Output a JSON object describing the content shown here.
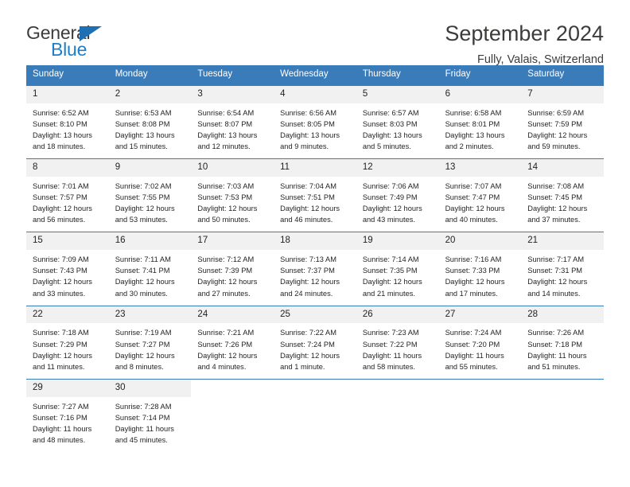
{
  "brand": {
    "name_top": "General",
    "name_bottom": "Blue",
    "triangle_color": "#1f6fb5",
    "blue_color": "#1f7fc4",
    "gray_color": "#3c3c3b"
  },
  "header": {
    "title": "September 2024",
    "subtitle": "Fully, Valais, Switzerland"
  },
  "colors": {
    "header_bg": "#3a7cba",
    "header_text": "#ffffff",
    "daynum_bg": "#f1f1f1",
    "cell_bg": "#ffffff",
    "text": "#231f20"
  },
  "weekdays": [
    "Sunday",
    "Monday",
    "Tuesday",
    "Wednesday",
    "Thursday",
    "Friday",
    "Saturday"
  ],
  "weeks": [
    [
      {
        "day": "1",
        "sunrise": "Sunrise: 6:52 AM",
        "sunset": "Sunset: 8:10 PM",
        "daylight_line1": "Daylight: 13 hours",
        "daylight_line2": "and 18 minutes."
      },
      {
        "day": "2",
        "sunrise": "Sunrise: 6:53 AM",
        "sunset": "Sunset: 8:08 PM",
        "daylight_line1": "Daylight: 13 hours",
        "daylight_line2": "and 15 minutes."
      },
      {
        "day": "3",
        "sunrise": "Sunrise: 6:54 AM",
        "sunset": "Sunset: 8:07 PM",
        "daylight_line1": "Daylight: 13 hours",
        "daylight_line2": "and 12 minutes."
      },
      {
        "day": "4",
        "sunrise": "Sunrise: 6:56 AM",
        "sunset": "Sunset: 8:05 PM",
        "daylight_line1": "Daylight: 13 hours",
        "daylight_line2": "and 9 minutes."
      },
      {
        "day": "5",
        "sunrise": "Sunrise: 6:57 AM",
        "sunset": "Sunset: 8:03 PM",
        "daylight_line1": "Daylight: 13 hours",
        "daylight_line2": "and 5 minutes."
      },
      {
        "day": "6",
        "sunrise": "Sunrise: 6:58 AM",
        "sunset": "Sunset: 8:01 PM",
        "daylight_line1": "Daylight: 13 hours",
        "daylight_line2": "and 2 minutes."
      },
      {
        "day": "7",
        "sunrise": "Sunrise: 6:59 AM",
        "sunset": "Sunset: 7:59 PM",
        "daylight_line1": "Daylight: 12 hours",
        "daylight_line2": "and 59 minutes."
      }
    ],
    [
      {
        "day": "8",
        "sunrise": "Sunrise: 7:01 AM",
        "sunset": "Sunset: 7:57 PM",
        "daylight_line1": "Daylight: 12 hours",
        "daylight_line2": "and 56 minutes."
      },
      {
        "day": "9",
        "sunrise": "Sunrise: 7:02 AM",
        "sunset": "Sunset: 7:55 PM",
        "daylight_line1": "Daylight: 12 hours",
        "daylight_line2": "and 53 minutes."
      },
      {
        "day": "10",
        "sunrise": "Sunrise: 7:03 AM",
        "sunset": "Sunset: 7:53 PM",
        "daylight_line1": "Daylight: 12 hours",
        "daylight_line2": "and 50 minutes."
      },
      {
        "day": "11",
        "sunrise": "Sunrise: 7:04 AM",
        "sunset": "Sunset: 7:51 PM",
        "daylight_line1": "Daylight: 12 hours",
        "daylight_line2": "and 46 minutes."
      },
      {
        "day": "12",
        "sunrise": "Sunrise: 7:06 AM",
        "sunset": "Sunset: 7:49 PM",
        "daylight_line1": "Daylight: 12 hours",
        "daylight_line2": "and 43 minutes."
      },
      {
        "day": "13",
        "sunrise": "Sunrise: 7:07 AM",
        "sunset": "Sunset: 7:47 PM",
        "daylight_line1": "Daylight: 12 hours",
        "daylight_line2": "and 40 minutes."
      },
      {
        "day": "14",
        "sunrise": "Sunrise: 7:08 AM",
        "sunset": "Sunset: 7:45 PM",
        "daylight_line1": "Daylight: 12 hours",
        "daylight_line2": "and 37 minutes."
      }
    ],
    [
      {
        "day": "15",
        "sunrise": "Sunrise: 7:09 AM",
        "sunset": "Sunset: 7:43 PM",
        "daylight_line1": "Daylight: 12 hours",
        "daylight_line2": "and 33 minutes."
      },
      {
        "day": "16",
        "sunrise": "Sunrise: 7:11 AM",
        "sunset": "Sunset: 7:41 PM",
        "daylight_line1": "Daylight: 12 hours",
        "daylight_line2": "and 30 minutes."
      },
      {
        "day": "17",
        "sunrise": "Sunrise: 7:12 AM",
        "sunset": "Sunset: 7:39 PM",
        "daylight_line1": "Daylight: 12 hours",
        "daylight_line2": "and 27 minutes."
      },
      {
        "day": "18",
        "sunrise": "Sunrise: 7:13 AM",
        "sunset": "Sunset: 7:37 PM",
        "daylight_line1": "Daylight: 12 hours",
        "daylight_line2": "and 24 minutes."
      },
      {
        "day": "19",
        "sunrise": "Sunrise: 7:14 AM",
        "sunset": "Sunset: 7:35 PM",
        "daylight_line1": "Daylight: 12 hours",
        "daylight_line2": "and 21 minutes."
      },
      {
        "day": "20",
        "sunrise": "Sunrise: 7:16 AM",
        "sunset": "Sunset: 7:33 PM",
        "daylight_line1": "Daylight: 12 hours",
        "daylight_line2": "and 17 minutes."
      },
      {
        "day": "21",
        "sunrise": "Sunrise: 7:17 AM",
        "sunset": "Sunset: 7:31 PM",
        "daylight_line1": "Daylight: 12 hours",
        "daylight_line2": "and 14 minutes."
      }
    ],
    [
      {
        "day": "22",
        "sunrise": "Sunrise: 7:18 AM",
        "sunset": "Sunset: 7:29 PM",
        "daylight_line1": "Daylight: 12 hours",
        "daylight_line2": "and 11 minutes."
      },
      {
        "day": "23",
        "sunrise": "Sunrise: 7:19 AM",
        "sunset": "Sunset: 7:27 PM",
        "daylight_line1": "Daylight: 12 hours",
        "daylight_line2": "and 8 minutes."
      },
      {
        "day": "24",
        "sunrise": "Sunrise: 7:21 AM",
        "sunset": "Sunset: 7:26 PM",
        "daylight_line1": "Daylight: 12 hours",
        "daylight_line2": "and 4 minutes."
      },
      {
        "day": "25",
        "sunrise": "Sunrise: 7:22 AM",
        "sunset": "Sunset: 7:24 PM",
        "daylight_line1": "Daylight: 12 hours",
        "daylight_line2": "and 1 minute."
      },
      {
        "day": "26",
        "sunrise": "Sunrise: 7:23 AM",
        "sunset": "Sunset: 7:22 PM",
        "daylight_line1": "Daylight: 11 hours",
        "daylight_line2": "and 58 minutes."
      },
      {
        "day": "27",
        "sunrise": "Sunrise: 7:24 AM",
        "sunset": "Sunset: 7:20 PM",
        "daylight_line1": "Daylight: 11 hours",
        "daylight_line2": "and 55 minutes."
      },
      {
        "day": "28",
        "sunrise": "Sunrise: 7:26 AM",
        "sunset": "Sunset: 7:18 PM",
        "daylight_line1": "Daylight: 11 hours",
        "daylight_line2": "and 51 minutes."
      }
    ],
    [
      {
        "day": "29",
        "sunrise": "Sunrise: 7:27 AM",
        "sunset": "Sunset: 7:16 PM",
        "daylight_line1": "Daylight: 11 hours",
        "daylight_line2": "and 48 minutes."
      },
      {
        "day": "30",
        "sunrise": "Sunrise: 7:28 AM",
        "sunset": "Sunset: 7:14 PM",
        "daylight_line1": "Daylight: 11 hours",
        "daylight_line2": "and 45 minutes."
      },
      {
        "day": "",
        "sunrise": "",
        "sunset": "",
        "daylight_line1": "",
        "daylight_line2": ""
      },
      {
        "day": "",
        "sunrise": "",
        "sunset": "",
        "daylight_line1": "",
        "daylight_line2": ""
      },
      {
        "day": "",
        "sunrise": "",
        "sunset": "",
        "daylight_line1": "",
        "daylight_line2": ""
      },
      {
        "day": "",
        "sunrise": "",
        "sunset": "",
        "daylight_line1": "",
        "daylight_line2": ""
      },
      {
        "day": "",
        "sunrise": "",
        "sunset": "",
        "daylight_line1": "",
        "daylight_line2": ""
      }
    ]
  ]
}
